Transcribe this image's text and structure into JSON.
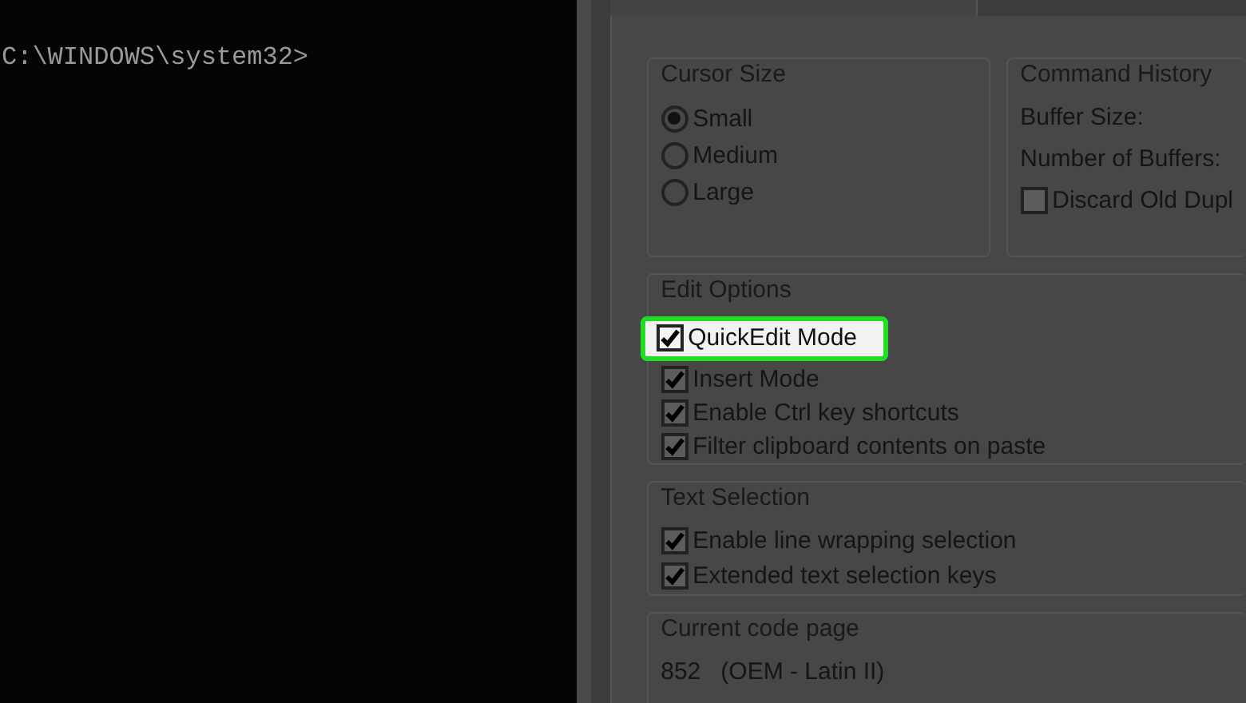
{
  "console": {
    "prompt": "C:\\WINDOWS\\system32>"
  },
  "cursor_size": {
    "title": "Cursor Size",
    "options": [
      {
        "label": "Small",
        "selected": true
      },
      {
        "label": "Medium",
        "selected": false
      },
      {
        "label": "Large",
        "selected": false
      }
    ]
  },
  "command_history": {
    "title": "Command History",
    "fields": [
      "Buffer Size:",
      "Number of Buffers:"
    ],
    "discard": {
      "label": "Discard Old Dupl",
      "checked": false
    }
  },
  "edit_options": {
    "title": "Edit Options",
    "items": [
      {
        "label": "QuickEdit Mode",
        "checked": true,
        "highlighted": true
      },
      {
        "label": "Insert Mode",
        "checked": true,
        "highlighted": false
      },
      {
        "label": "Enable Ctrl key shortcuts",
        "checked": true,
        "highlighted": false
      },
      {
        "label": "Filter clipboard contents on paste",
        "checked": true,
        "highlighted": false
      }
    ]
  },
  "text_selection": {
    "title": "Text Selection",
    "items": [
      {
        "label": "Enable line wrapping selection",
        "checked": true
      },
      {
        "label": "Extended text selection keys",
        "checked": true
      }
    ]
  },
  "code_page": {
    "title": "Current code page",
    "value": "852   (OEM - Latin II)"
  }
}
